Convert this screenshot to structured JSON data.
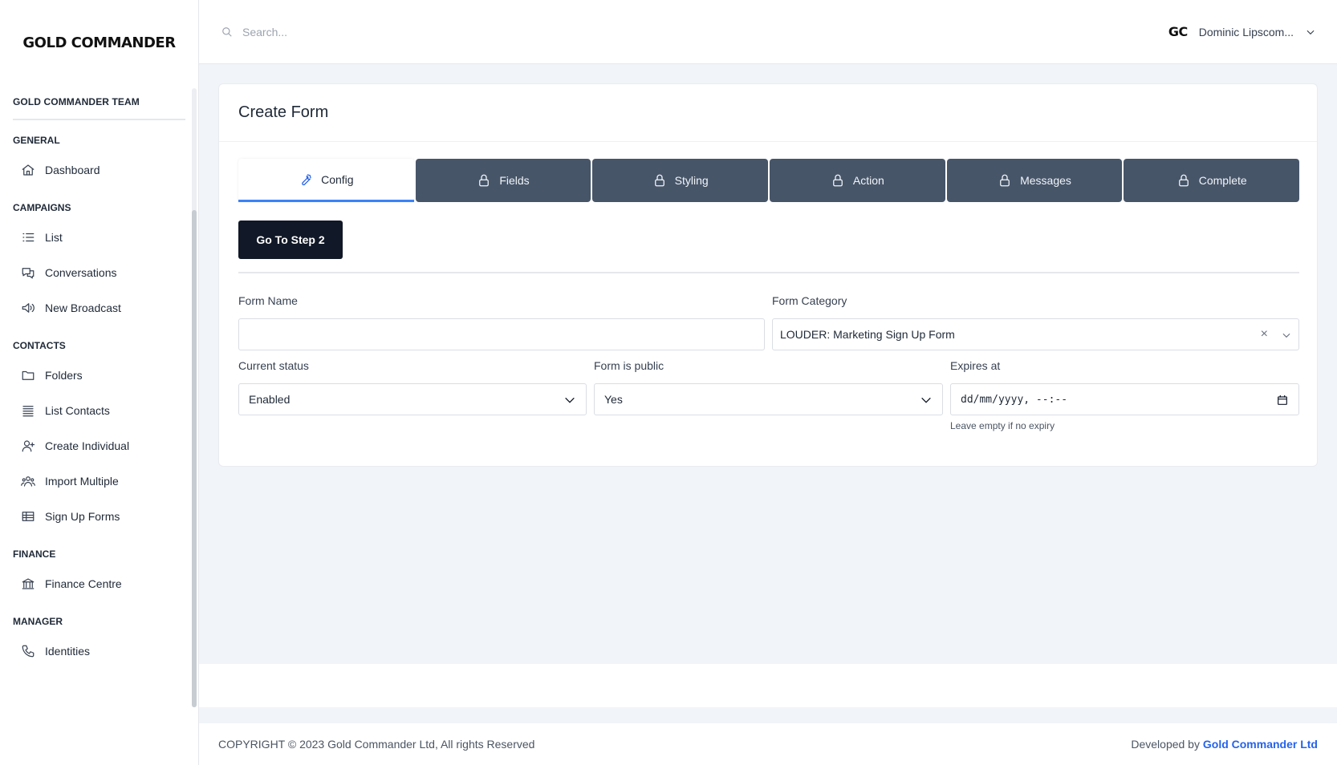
{
  "brand": {
    "logo": "GOLD COMMANDER",
    "team": "GOLD COMMANDER TEAM"
  },
  "sidebar": {
    "sections": [
      {
        "title": "GENERAL",
        "items": [
          {
            "label": "Dashboard",
            "icon": "home-icon"
          }
        ]
      },
      {
        "title": "CAMPAIGNS",
        "items": [
          {
            "label": "List",
            "icon": "list-icon"
          },
          {
            "label": "Conversations",
            "icon": "chat-icon"
          },
          {
            "label": "New Broadcast",
            "icon": "megaphone-icon"
          }
        ]
      },
      {
        "title": "CONTACTS",
        "items": [
          {
            "label": "Folders",
            "icon": "folder-icon"
          },
          {
            "label": "List Contacts",
            "icon": "stack-icon"
          },
          {
            "label": "Create Individual",
            "icon": "user-plus-icon"
          },
          {
            "label": "Import Multiple",
            "icon": "users-icon"
          },
          {
            "label": "Sign Up Forms",
            "icon": "table-icon"
          }
        ]
      },
      {
        "title": "FINANCE",
        "items": [
          {
            "label": "Finance Centre",
            "icon": "bank-icon"
          }
        ]
      },
      {
        "title": "MANAGER",
        "items": [
          {
            "label": "Identities",
            "icon": "phone-icon"
          }
        ]
      }
    ]
  },
  "header": {
    "search_placeholder": "Search...",
    "user_initials": "GC",
    "user_name": "Dominic Lipscom..."
  },
  "form": {
    "title": "Create Form",
    "tabs": [
      {
        "label": "Config",
        "icon": "wrench-icon",
        "active": true
      },
      {
        "label": "Fields",
        "icon": "lock-icon",
        "active": false
      },
      {
        "label": "Styling",
        "icon": "lock-icon",
        "active": false
      },
      {
        "label": "Action",
        "icon": "lock-icon",
        "active": false
      },
      {
        "label": "Messages",
        "icon": "lock-icon",
        "active": false
      },
      {
        "label": "Complete",
        "icon": "lock-icon",
        "active": false
      }
    ],
    "step_button": "Go To Step 2",
    "form_name_label": "Form Name",
    "form_name_value": "",
    "form_category_label": "Form Category",
    "form_category_value": "LOUDER: Marketing Sign Up Form",
    "status_label": "Current status",
    "status_value": "Enabled",
    "public_label": "Form is public",
    "public_value": "Yes",
    "expires_label": "Expires at",
    "expires_value": "dd/mm/yyyy, --:--",
    "expires_hint": "Leave empty if no expiry"
  },
  "footer": {
    "copyright": "COPYRIGHT © 2023 Gold Commander Ltd, All rights Reserved",
    "developed_by": "Developed by",
    "developer": "Gold Commander Ltd"
  },
  "colors": {
    "locked_tab": "#475569",
    "active_accent": "#3b82f6",
    "primary_button": "#111827",
    "link": "#2563eb"
  }
}
